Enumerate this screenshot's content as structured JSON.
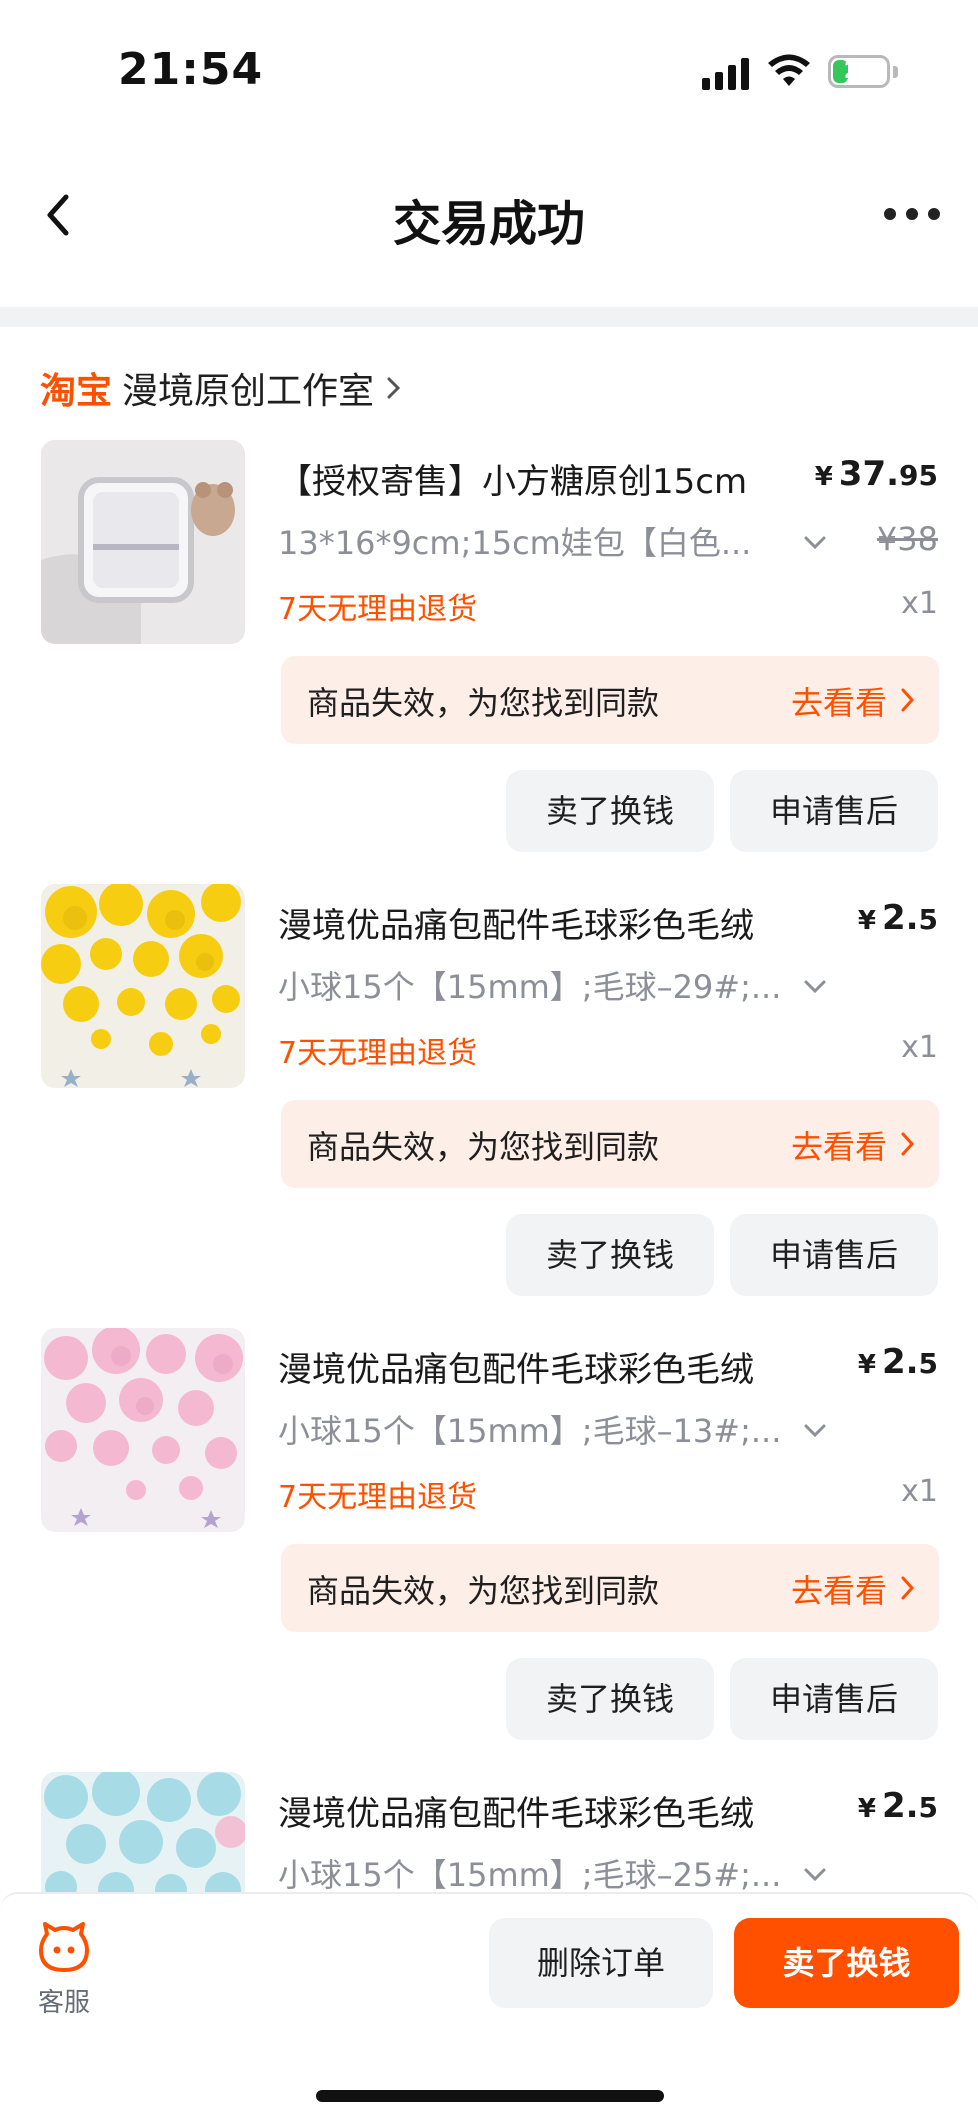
{
  "status_bar": {
    "time": "21:54",
    "battery": "27"
  },
  "nav": {
    "title": "交易成功",
    "back_icon": "chevron-left-icon",
    "more_icon": "more-dots-icon"
  },
  "shop": {
    "platform": "淘宝",
    "name": "漫境原创工作室"
  },
  "items": [
    {
      "title": "【授权寄售】小方糖原创15cm",
      "price_main": "37.",
      "price_dec": "95",
      "original_price": "¥38",
      "sku": "13*16*9cm;15cm娃包【白色...",
      "return_policy": "7天无理由退货",
      "quantity": "x1",
      "notice": "商品失效，为您找到同款",
      "notice_link": "去看看",
      "btn_sell": "卖了换钱",
      "btn_after": "申请售后",
      "thumb_color": "#e9e6e8"
    },
    {
      "title": "漫境优品痛包配件毛球彩色毛绒",
      "price_main": "2.",
      "price_dec": "5",
      "sku": "小球15个【15mm】;毛球–29#;...",
      "return_policy": "7天无理由退货",
      "quantity": "x1",
      "notice": "商品失效，为您找到同款",
      "notice_link": "去看看",
      "btn_sell": "卖了换钱",
      "btn_after": "申请售后",
      "thumb_color": "#f5cc12"
    },
    {
      "title": "漫境优品痛包配件毛球彩色毛绒",
      "price_main": "2.",
      "price_dec": "5",
      "sku": "小球15个【15mm】;毛球–13#;...",
      "return_policy": "7天无理由退货",
      "quantity": "x1",
      "notice": "商品失效，为您找到同款",
      "notice_link": "去看看",
      "btn_sell": "卖了换钱",
      "btn_after": "申请售后",
      "thumb_color": "#f3b6cf"
    },
    {
      "title": "漫境优品痛包配件毛球彩色毛绒",
      "price_main": "2.",
      "price_dec": "5",
      "sku": "小球15个【15mm】;毛球–25#;...",
      "thumb_color": "#a9dbe6"
    }
  ],
  "currency": "¥",
  "bottom_bar": {
    "service_label": "客服",
    "delete_label": "删除订单",
    "primary_label": "卖了换钱"
  },
  "colors": {
    "accent": "#ff5000",
    "notice_bg": "#fdeee7",
    "button_bg": "#f2f3f5"
  }
}
